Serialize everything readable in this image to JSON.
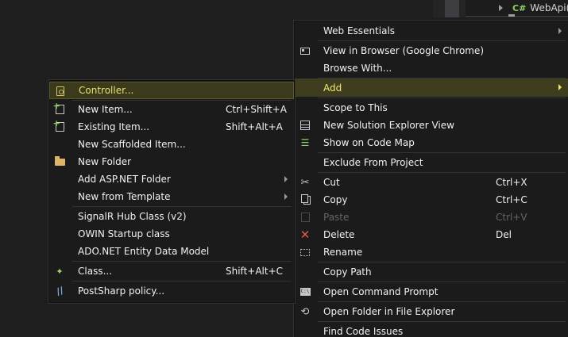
{
  "solution_explorer": {
    "badge": "C#",
    "node_label": "WebApi("
  },
  "main_menu": {
    "items": [
      {
        "label": "Web Essentials",
        "shortcut": "",
        "icon": "",
        "submenu": true
      },
      {
        "label": "View in Browser (Google Chrome)",
        "shortcut": "",
        "icon": "browser-icon"
      },
      {
        "label": "Browse With...",
        "shortcut": "",
        "icon": ""
      },
      {
        "label": "Add",
        "shortcut": "",
        "icon": "",
        "submenu": true,
        "highlight": true
      },
      {
        "label": "Scope to This",
        "shortcut": "",
        "icon": ""
      },
      {
        "label": "New Solution Explorer View",
        "shortcut": "",
        "icon": "solution-explorer-view-icon"
      },
      {
        "label": "Show on Code Map",
        "shortcut": "",
        "icon": "code-map-icon"
      },
      {
        "label": "Exclude From Project",
        "shortcut": "",
        "icon": ""
      },
      {
        "label": "Cut",
        "shortcut": "Ctrl+X",
        "icon": "scissors-icon"
      },
      {
        "label": "Copy",
        "shortcut": "Ctrl+C",
        "icon": "copy-icon"
      },
      {
        "label": "Paste",
        "shortcut": "Ctrl+V",
        "icon": "paste-icon",
        "disabled": true
      },
      {
        "label": "Delete",
        "shortcut": "Del",
        "icon": "delete-icon"
      },
      {
        "label": "Rename",
        "shortcut": "",
        "icon": "rename-icon"
      },
      {
        "label": "Copy Path",
        "shortcut": "",
        "icon": ""
      },
      {
        "label": "Open Command Prompt",
        "shortcut": "",
        "icon": "command-prompt-icon"
      },
      {
        "label": "Open Folder in File Explorer",
        "shortcut": "",
        "icon": "open-folder-icon"
      },
      {
        "label": "Find Code Issues",
        "shortcut": "",
        "icon": ""
      }
    ]
  },
  "add_submenu": {
    "items": [
      {
        "label": "Controller...",
        "shortcut": "",
        "icon": "controller-icon",
        "selected": true
      },
      {
        "label": "New Item...",
        "shortcut": "Ctrl+Shift+A",
        "icon": "new-item-icon"
      },
      {
        "label": "Existing Item...",
        "shortcut": "Shift+Alt+A",
        "icon": "existing-item-icon"
      },
      {
        "label": "New Scaffolded Item...",
        "shortcut": "",
        "icon": ""
      },
      {
        "label": "New Folder",
        "shortcut": "",
        "icon": "folder-icon"
      },
      {
        "label": "Add ASP.NET Folder",
        "shortcut": "",
        "icon": "",
        "submenu": true
      },
      {
        "label": "New from Template",
        "shortcut": "",
        "icon": "",
        "submenu": true
      },
      {
        "label": "SignalR Hub Class (v2)",
        "shortcut": "",
        "icon": ""
      },
      {
        "label": "OWIN Startup class",
        "shortcut": "",
        "icon": ""
      },
      {
        "label": "ADO.NET Entity Data Model",
        "shortcut": "",
        "icon": ""
      },
      {
        "label": "Class...",
        "shortcut": "Shift+Alt+C",
        "icon": "class-icon"
      },
      {
        "label": "PostSharp policy...",
        "shortcut": "",
        "icon": "postsharp-icon"
      }
    ]
  }
}
